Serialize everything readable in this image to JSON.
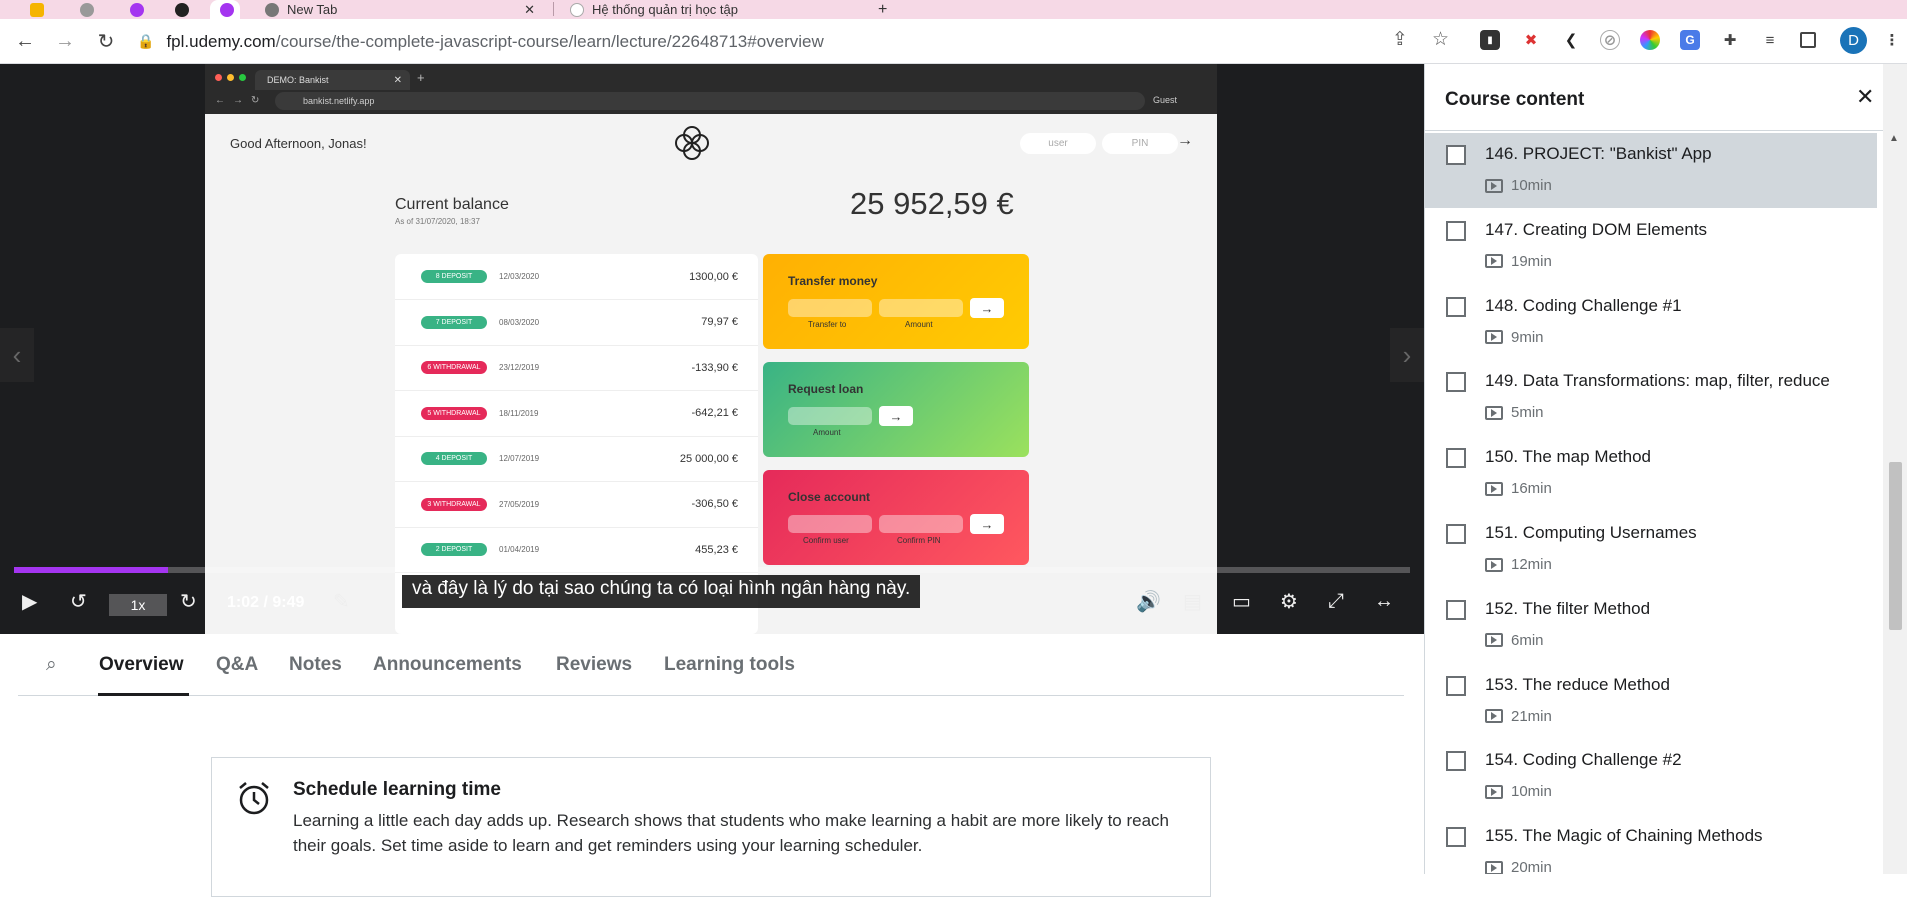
{
  "browser": {
    "tabs": [
      "New Tab",
      "Hệ thống quản trị học tập"
    ],
    "url_host": "fpl.udemy.com",
    "url_path": "/course/the-complete-javascript-course/learn/lecture/22648713#overview",
    "profile_initial": "D"
  },
  "video": {
    "demo": {
      "tab_title": "DEMO: Bankist",
      "url": "bankist.netlify.app",
      "guest": "Guest",
      "greeting": "Good Afternoon, Jonas!",
      "login_user_placeholder": "user",
      "login_pin_placeholder": "PIN",
      "balance_label": "Current balance",
      "balance_date": "As of 31/07/2020, 18:37",
      "balance_amount": "25 952,59 €",
      "movements": [
        {
          "badge": "8 DEPOSIT",
          "type": "deposit",
          "date": "12/03/2020",
          "value": "1300,00 €"
        },
        {
          "badge": "7 DEPOSIT",
          "type": "deposit",
          "date": "08/03/2020",
          "value": "79,97 €"
        },
        {
          "badge": "6 WITHDRAWAL",
          "type": "withdrawal",
          "date": "23/12/2019",
          "value": "-133,90 €"
        },
        {
          "badge": "5 WITHDRAWAL",
          "type": "withdrawal",
          "date": "18/11/2019",
          "value": "-642,21 €"
        },
        {
          "badge": "4 DEPOSIT",
          "type": "deposit",
          "date": "12/07/2019",
          "value": "25 000,00 €"
        },
        {
          "badge": "3 WITHDRAWAL",
          "type": "withdrawal",
          "date": "27/05/2019",
          "value": "-306,50 €"
        },
        {
          "badge": "2 DEPOSIT",
          "type": "deposit",
          "date": "01/04/2019",
          "value": "455,23 €"
        }
      ],
      "transfer": {
        "title": "Transfer money",
        "label1": "Transfer to",
        "label2": "Amount"
      },
      "loan": {
        "title": "Request loan",
        "label1": "Amount"
      },
      "close": {
        "title": "Close account",
        "label1": "Confirm user",
        "label2": "Confirm PIN"
      },
      "arrow": "→"
    },
    "playback_rate": "1x",
    "time": "1:02 / 9:49",
    "progress": 0.11,
    "caption": "và đây là lý do tại sao chúng ta có loại hình ngân hàng này."
  },
  "tabs": [
    "Overview",
    "Q&A",
    "Notes",
    "Announcements",
    "Reviews",
    "Learning tools"
  ],
  "schedule": {
    "title": "Schedule learning time",
    "body": "Learning a little each day adds up. Research shows that students who make learning a habit are more likely to reach their goals. Set time aside to learn and get reminders using your learning scheduler."
  },
  "sidebar": {
    "title": "Course content",
    "lectures": [
      {
        "title": "146. PROJECT: \"Bankist\" App",
        "duration": "10min",
        "current": true
      },
      {
        "title": "147. Creating DOM Elements",
        "duration": "19min",
        "current": false
      },
      {
        "title": "148. Coding Challenge #1",
        "duration": "9min",
        "current": false
      },
      {
        "title": "149. Data Transformations: map, filter, reduce",
        "duration": "5min",
        "current": false
      },
      {
        "title": "150. The map Method",
        "duration": "16min",
        "current": false
      },
      {
        "title": "151. Computing Usernames",
        "duration": "12min",
        "current": false
      },
      {
        "title": "152. The filter Method",
        "duration": "6min",
        "current": false
      },
      {
        "title": "153. The reduce Method",
        "duration": "21min",
        "current": false
      },
      {
        "title": "154. Coding Challenge #2",
        "duration": "10min",
        "current": false
      },
      {
        "title": "155. The Magic of Chaining Methods",
        "duration": "20min",
        "current": false
      }
    ]
  }
}
